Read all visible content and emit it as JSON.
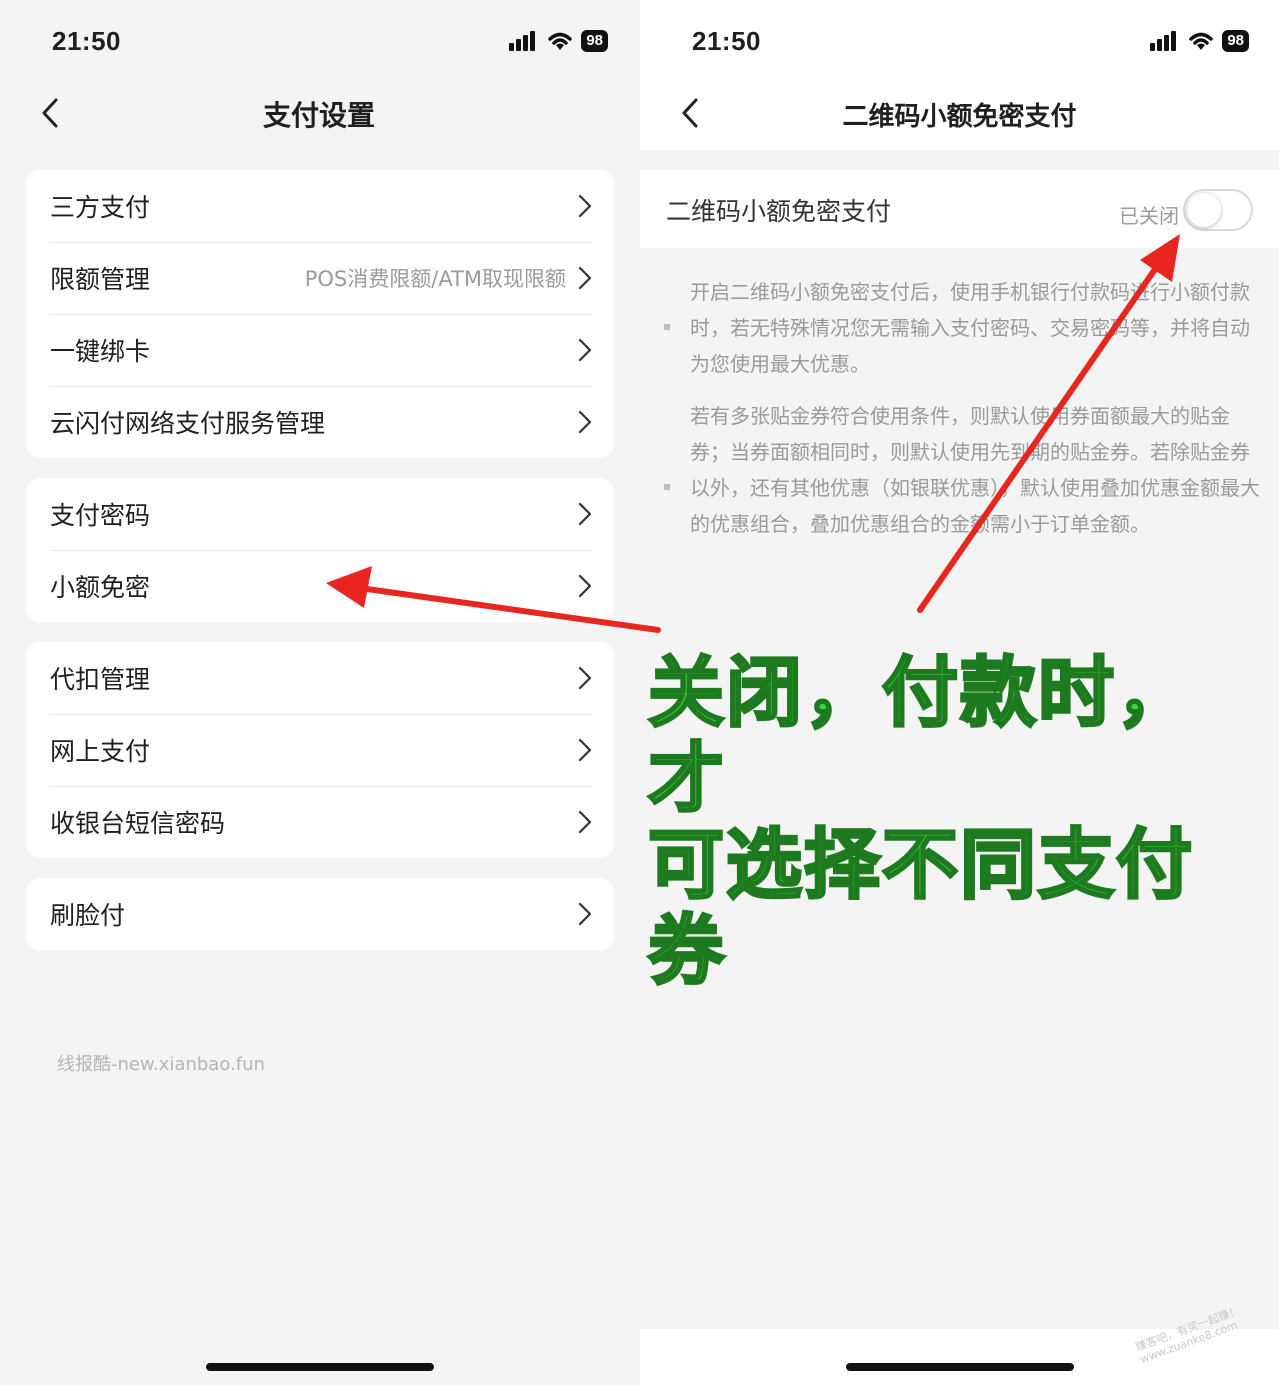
{
  "left": {
    "status": {
      "time": "21:50",
      "battery": "98"
    },
    "nav": {
      "title": "支付设置"
    },
    "groups": [
      {
        "items": [
          {
            "label": "三方支付",
            "value": ""
          },
          {
            "label": "限额管理",
            "value": "POS消费限额/ATM取现限额"
          },
          {
            "label": "一键绑卡",
            "value": ""
          },
          {
            "label": "云闪付网络支付服务管理",
            "value": ""
          }
        ]
      },
      {
        "items": [
          {
            "label": "支付密码",
            "value": ""
          },
          {
            "label": "小额免密",
            "value": ""
          }
        ]
      },
      {
        "items": [
          {
            "label": "代扣管理",
            "value": ""
          },
          {
            "label": "网上支付",
            "value": ""
          },
          {
            "label": "收银台短信密码",
            "value": ""
          }
        ]
      },
      {
        "items": [
          {
            "label": "刷脸付",
            "value": ""
          }
        ]
      }
    ],
    "watermark": "线报酷-new.xianbao.fun"
  },
  "right": {
    "status": {
      "time": "21:50",
      "battery": "98"
    },
    "nav": {
      "title": "二维码小额免密支付"
    },
    "setting": {
      "label": "二维码小额免密支付",
      "state": "已关闭",
      "enabled": false
    },
    "notes": [
      "开启二维码小额免密支付后，使用手机银行付款码进行小额付款时，若无特殊情况您无需输入支付密码、交易密码等，并将自动为您使用最大优惠。",
      "若有多张贴金券符合使用条件，则默认使用券面额最大的贴金券；当券面额相同时，则默认使用先到期的贴金券。若除贴金券以外，还有其他优惠（如银联优惠），默认使用叠加优惠金额最大的优惠组合，叠加优惠组合的金额需小于订单金额。"
    ]
  },
  "annotation": {
    "callout_line1": "关闭，付款时，才",
    "callout_line2": "可选择不同支付券",
    "arrow_color": "#e8261f",
    "callout_color": "#3fcf3f"
  },
  "stamp": {
    "line1": "赚客吧，有奖一起赚！",
    "line2": "www.zuanke8.com"
  }
}
